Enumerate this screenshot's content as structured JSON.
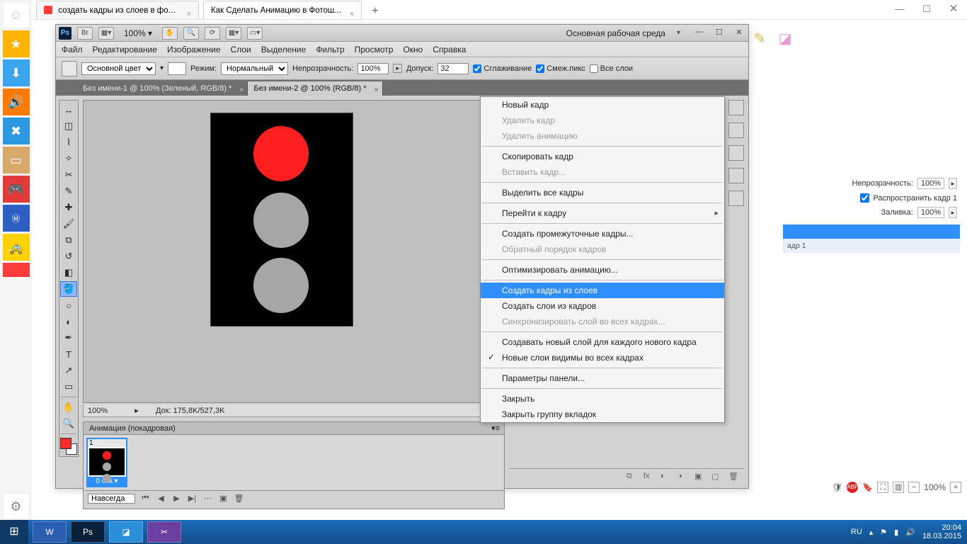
{
  "browser": {
    "tabs": [
      {
        "title": "создать кадры из слоев в фото...",
        "favColor": "#ff0000"
      },
      {
        "title": "Как Сделать Анимацию в Фотош...",
        "favColor": "#ffffff"
      }
    ],
    "window_controls": {
      "min": "—",
      "max": "☐",
      "close": "✕"
    },
    "toolbar": {
      "pencil": "✎",
      "eraser": "◧"
    }
  },
  "side_panel": {
    "opacity_label": "Непрозрачность:",
    "opacity_value": "100%",
    "propagate_label": "Распространить кадр 1",
    "fill_label": "Заливка:",
    "fill_value": "100%",
    "row_hint": "адр 1"
  },
  "zoom": {
    "value": "100%",
    "minus": "−",
    "plus": "+"
  },
  "ps": {
    "titlebar": {
      "br": "Br",
      "zoom": "100%",
      "workspace": "Основная рабочая среда"
    },
    "menu": [
      "Файл",
      "Редактирование",
      "Изображение",
      "Слои",
      "Выделение",
      "Фильтр",
      "Просмотр",
      "Окно",
      "Справка"
    ],
    "options": {
      "fill_label": "Основной цвет",
      "mode_label": "Режим:",
      "mode_value": "Нормальный",
      "opacity_label": "Непрозрачность:",
      "opacity_value": "100%",
      "tolerance_label": "Допуск:",
      "tolerance_value": "32",
      "antialias": "Сглаживание",
      "contiguous": "Смеж.пикс",
      "all_layers": "Все слои"
    },
    "doctabs": [
      "Без имени-1 @ 100% (Зеленый, RGB/8) *",
      "Без имени-2 @ 100% (RGB/8) *"
    ],
    "status": {
      "zoom": "100%",
      "doc": "Док: 175,8K/527,3K"
    },
    "anim": {
      "title": "Анимация (покадровая)",
      "frame_num": "1",
      "frame_time": "0 сек.",
      "loop": "Навсегда"
    }
  },
  "ctx": {
    "new_frame": "Новый кадр",
    "delete_frame": "Удалить кадр",
    "delete_anim": "Удалить анимацию",
    "copy_frame": "Скопировать кадр",
    "paste_frame": "Вставить кадр...",
    "select_all": "Выделить все кадры",
    "goto": "Перейти к кадру",
    "tween": "Создать промежуточные кадры...",
    "reverse": "Обратный порядок кадров",
    "optimize": "Оптимизировать анимацию...",
    "make_frames": "Создать кадры из слоев",
    "flatten": "Создать слои из кадров",
    "match": "Синхронизировать слой во всех кадрах...",
    "new_layer_each": "Создавать новый слой для каждого нового кадра",
    "visible_all": "Новые слои видимы во всех кадрах",
    "panel_opts": "Параметры панели...",
    "close": "Закрыть",
    "close_group": "Закрыть группу вкладок"
  },
  "taskbar": {
    "lang": "RU",
    "time": "20:04",
    "date": "18.03.2015"
  }
}
